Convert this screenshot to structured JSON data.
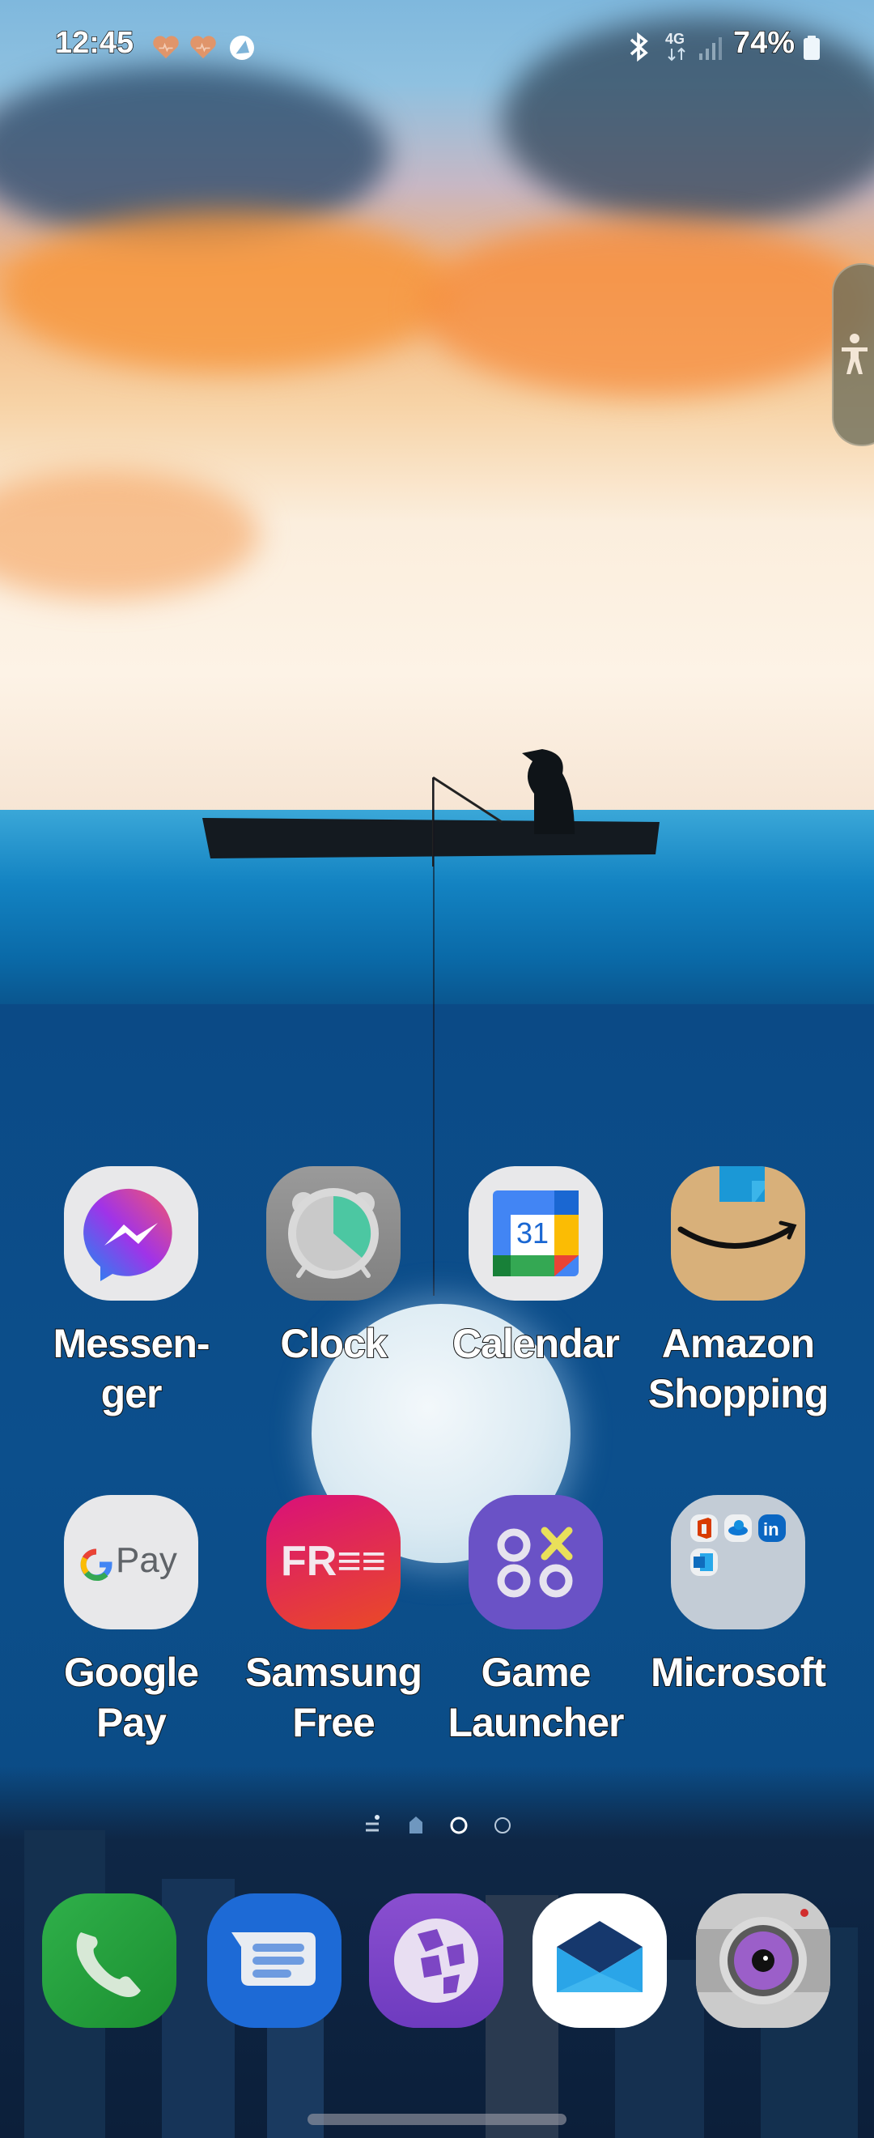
{
  "status_bar": {
    "time": "12:45",
    "notification_icons": [
      "health-heart-icon",
      "health-heart-icon",
      "app-notification-icon"
    ],
    "bluetooth": "bluetooth-icon",
    "network_type": "4G",
    "signal": "signal-bars-icon",
    "battery_percent": "74%",
    "battery_level": 0.74
  },
  "accessibility_button": {
    "icon": "accessibility-icon"
  },
  "home_apps": [
    {
      "label": "Messen-\nger",
      "line1": "Messen-",
      "line2": "ger",
      "icon": "messenger-icon"
    },
    {
      "label": "Clock",
      "line1": "Clock",
      "line2": "",
      "icon": "clock-icon"
    },
    {
      "label": "Calendar",
      "line1": "Calendar",
      "line2": "",
      "icon": "calendar-icon",
      "day": "31"
    },
    {
      "label": "Amazon Shopping",
      "line1": "Amazon",
      "line2": "Shopping",
      "icon": "amazon-icon"
    },
    {
      "label": "Google Pay",
      "line1": "Google",
      "line2": "Pay",
      "icon": "google-pay-icon",
      "icon_text": "Pay"
    },
    {
      "label": "Samsung Free",
      "line1": "Samsung",
      "line2": "Free",
      "icon": "samsung-free-icon",
      "icon_text": "FR≡≡"
    },
    {
      "label": "Game Launcher",
      "line1": "Game",
      "line2": "Launcher",
      "icon": "game-launcher-icon"
    },
    {
      "label": "Microsoft",
      "line1": "Microsoft",
      "line2": "",
      "icon": "folder-icon",
      "folder_items": [
        "office-icon",
        "onedrive-icon",
        "linkedin-icon",
        "outlook-icon"
      ]
    }
  ],
  "page_indicator": {
    "pages": 3,
    "current_page": 1,
    "has_feed_page": true,
    "has_home_marker": true
  },
  "dock": [
    {
      "name": "Phone",
      "icon": "phone-icon"
    },
    {
      "name": "Messages",
      "icon": "messages-icon"
    },
    {
      "name": "Internet",
      "icon": "internet-icon"
    },
    {
      "name": "Email",
      "icon": "email-icon"
    },
    {
      "name": "Camera",
      "icon": "camera-icon"
    }
  ],
  "colors": {
    "messenger_gradient": [
      "#1b8cf2",
      "#a033e8",
      "#f5566c"
    ],
    "clock_bg": "#8e8e8e",
    "clock_accent": "#4cc7a2",
    "amazon_bg": "#d8b07a",
    "amazon_tape": "#2a9fd8",
    "samsung_free": [
      "#d9107a",
      "#ea4b25"
    ],
    "game_launcher": "#6a52c6",
    "game_launcher_x": "#e9e05a",
    "phone_bg": "#20a23a",
    "messages_bg": "#1d6ad6",
    "internet_bg": "#7d46c4",
    "email_bg": "#ffffff",
    "camera_bg": "#c8c8c8"
  }
}
